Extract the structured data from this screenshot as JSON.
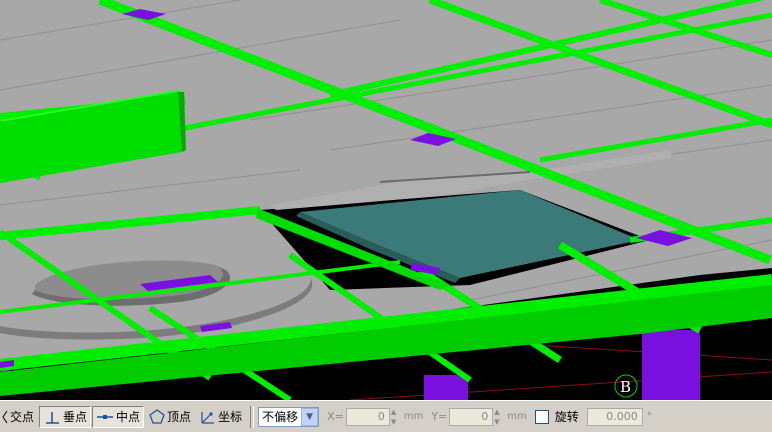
{
  "viewport": {
    "axis_marker": "B",
    "colors": {
      "background": "#000000",
      "slab": "#a8a8a8",
      "beam": "#00ff00",
      "column": "#7a10e0",
      "opening": "#3a7a78"
    }
  },
  "snap_toolbar": {
    "items": [
      {
        "label": "交点",
        "icon": "intersection-icon",
        "active": false
      },
      {
        "label": "垂点",
        "icon": "perpendicular-icon",
        "active": true
      },
      {
        "label": "中点",
        "icon": "midpoint-icon",
        "active": true
      },
      {
        "label": "顶点",
        "icon": "vertex-icon",
        "active": false
      },
      {
        "label": "坐标",
        "icon": "coordinate-icon",
        "active": false
      }
    ],
    "offset_mode": "不偏移",
    "x_label": "X=",
    "x_value": "0",
    "y_label": "Y=",
    "y_value": "0",
    "unit": "mm",
    "rotate_label": "旋转",
    "rotate_value": "0.000",
    "degree_symbol": "°"
  }
}
